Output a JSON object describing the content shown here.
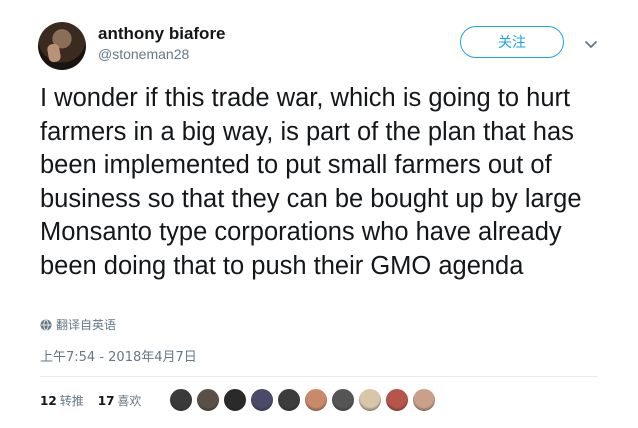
{
  "user": {
    "name": "anthony biafore",
    "handle": "@stoneman28"
  },
  "follow_label": "关注",
  "tweet": {
    "text": "I wonder if this trade war, which is going to hurt farmers in a big way, is part of the plan that has been implemented to put small farmers out of business so that they can be bought up by large Monsanto type corporations who have already been doing that to push their GMO agenda",
    "translate_label": "翻译自英语",
    "timestamp": "上午7:54 - 2018年4月7日"
  },
  "stats": {
    "retweets_count": "12",
    "retweets_label": "转推",
    "likes_count": "17",
    "likes_label": "喜欢"
  },
  "liker_colors": [
    "#3a3a3a",
    "#5a5048",
    "#2a2a2a",
    "#4a4a6a",
    "#3c3c3c",
    "#c98a6a",
    "#555555",
    "#d8c6a8",
    "#b8554a",
    "#caa08a"
  ],
  "colors": {
    "accent": "#1da1f2",
    "secondary_text": "#657786"
  }
}
